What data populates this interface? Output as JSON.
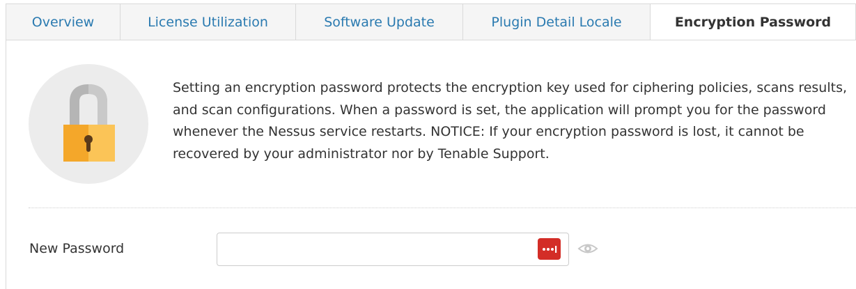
{
  "tabs": [
    {
      "label": "Overview",
      "active": false
    },
    {
      "label": "License Utilization",
      "active": false
    },
    {
      "label": "Software Update",
      "active": false
    },
    {
      "label": "Plugin Detail Locale",
      "active": false
    },
    {
      "label": "Encryption Password",
      "active": true
    }
  ],
  "main": {
    "description": "Setting an encryption password protects the encryption key used for ciphering policies, scans results, and scan configurations. When a password is set, the application will prompt you for the password whenever the Nessus service restarts. NOTICE: If your encryption password is lost, it cannot be recovered by your administrator nor by Tenable Support.",
    "lock_icon": "padlock-icon"
  },
  "form": {
    "new_password_label": "New Password",
    "new_password_value": "",
    "password_manager_icon": "password-manager-icon",
    "toggle_visibility_icon": "eye-icon"
  },
  "colors": {
    "link": "#2a7ab0",
    "lock_body": "#f4a72a",
    "password_manager": "#d32d27"
  }
}
